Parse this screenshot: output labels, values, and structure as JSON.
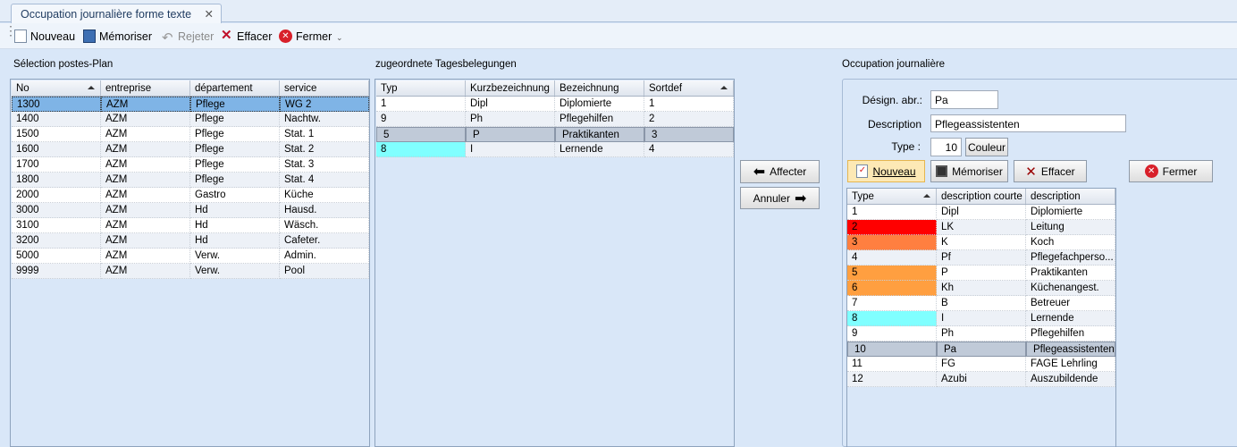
{
  "tab": {
    "title": "Occupation journalière forme texte",
    "close": "✕"
  },
  "toolbar": {
    "nouveau": "Nouveau",
    "memoriser": "Mémoriser",
    "rejeter": "Rejeter",
    "effacer": "Effacer",
    "fermer": "Fermer"
  },
  "left": {
    "title": "Sélection postes-Plan",
    "columns": [
      "No",
      "entreprise",
      "département",
      "service"
    ],
    "rows": [
      [
        "1300",
        "AZM",
        "Pflege",
        "WG 2"
      ],
      [
        "1400",
        "AZM",
        "Pflege",
        "Nachtw."
      ],
      [
        "1500",
        "AZM",
        "Pflege",
        "Stat. 1"
      ],
      [
        "1600",
        "AZM",
        "Pflege",
        "Stat. 2"
      ],
      [
        "1700",
        "AZM",
        "Pflege",
        "Stat. 3"
      ],
      [
        "1800",
        "AZM",
        "Pflege",
        "Stat. 4"
      ],
      [
        "2000",
        "AZM",
        "Gastro",
        "Küche"
      ],
      [
        "3000",
        "AZM",
        "Hd",
        "Hausd."
      ],
      [
        "3100",
        "AZM",
        "Hd",
        "Wäsch."
      ],
      [
        "3200",
        "AZM",
        "Hd",
        "Cafeter."
      ],
      [
        "5000",
        "AZM",
        "Verw.",
        "Admin."
      ],
      [
        "9999",
        "AZM",
        "Verw.",
        "Pool"
      ]
    ]
  },
  "middle": {
    "title": "zugeordnete Tagesbelegungen",
    "columns": [
      "Typ",
      "Kurzbezeichnung",
      "Bezeichnung",
      "Sortdef"
    ],
    "rows": [
      [
        "1",
        "Dipl",
        "Diplomierte",
        "1"
      ],
      [
        "9",
        "Ph",
        "Pflegehilfen",
        "2"
      ],
      [
        "5",
        "P",
        "Praktikanten",
        "3"
      ],
      [
        "8",
        "I",
        "Lernende",
        "4"
      ]
    ],
    "colors": [
      "",
      "",
      "",
      "#80ffff"
    ]
  },
  "actions": {
    "affecter": "Affecter",
    "annuler": "Annuler"
  },
  "right": {
    "title": "Occupation journalière",
    "form": {
      "design_label": "Désign. abr.:",
      "design_value": "Pa",
      "desc_label": "Description",
      "desc_value": "Pflegeassistenten",
      "type_label": "Type :",
      "type_value": "10",
      "couleur": "Couleur"
    },
    "buttons": {
      "nouveau": "Nouveau",
      "memoriser": "Mémoriser",
      "effacer": "Effacer",
      "fermer": "Fermer"
    },
    "columns": [
      "Type",
      "description courte",
      "description"
    ],
    "rows": [
      [
        "1",
        "Dipl",
        "Diplomierte"
      ],
      [
        "2",
        "LK",
        "Leitung"
      ],
      [
        "3",
        "K",
        "Koch"
      ],
      [
        "4",
        "Pf",
        "Pflegefachperso..."
      ],
      [
        "5",
        "P",
        "Praktikanten"
      ],
      [
        "6",
        "Kh",
        "Küchenangest."
      ],
      [
        "7",
        "B",
        "Betreuer"
      ],
      [
        "8",
        "I",
        "Lernende"
      ],
      [
        "9",
        "Ph",
        "Pflegehilfen"
      ],
      [
        "10",
        "Pa",
        "Pflegeassistenten"
      ],
      [
        "11",
        "FG",
        "FAGE Lehrling"
      ],
      [
        "12",
        "Azubi",
        "Auszubildende"
      ]
    ],
    "colors": [
      "",
      "#ff0000",
      "#ff7f40",
      "",
      "#ff9f40",
      "#ff9f40",
      "",
      "#80ffff",
      "",
      "",
      "",
      ""
    ]
  }
}
